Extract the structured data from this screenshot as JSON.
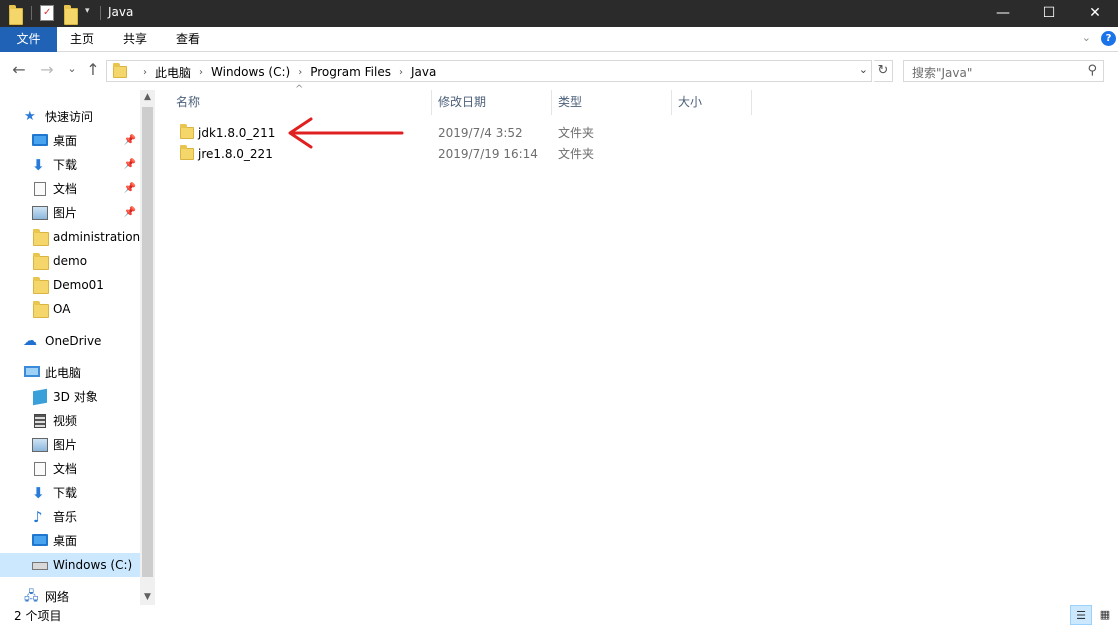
{
  "window": {
    "title": "Java",
    "minimize_glyph": "—",
    "maximize_glyph": "☐",
    "close_glyph": "✕"
  },
  "quick_access_toolbar": {
    "icons": [
      "folder-icon",
      "properties-icon",
      "new-folder-icon",
      "customize-dropdown-icon"
    ]
  },
  "ribbon": {
    "tabs": [
      {
        "label": "文件",
        "active": true
      },
      {
        "label": "主页"
      },
      {
        "label": "共享"
      },
      {
        "label": "查看"
      }
    ],
    "expand_glyph": "⌄",
    "help_glyph": "?"
  },
  "navigation": {
    "back_glyph": "←",
    "forward_glyph": "→",
    "recent_glyph": "⌄",
    "up_glyph": "↑"
  },
  "address_bar": {
    "crumbs": [
      "此电脑",
      "Windows (C:)",
      "Program Files",
      "Java"
    ],
    "separator": "›",
    "dropdown_glyph": "⌄",
    "refresh_glyph": "↻"
  },
  "search": {
    "placeholder": "搜索\"Java\"",
    "icon_glyph": "⚲"
  },
  "nav_pane": {
    "items": [
      {
        "label": "快速访问",
        "icon": "star-icon",
        "pinned": false,
        "level": 0
      },
      {
        "label": "桌面",
        "icon": "desktop-icon",
        "pinned": true,
        "level": 1
      },
      {
        "label": "下载",
        "icon": "download-icon",
        "pinned": true,
        "level": 1
      },
      {
        "label": "文档",
        "icon": "document-icon",
        "pinned": true,
        "level": 1
      },
      {
        "label": "图片",
        "icon": "pictures-icon",
        "pinned": true,
        "level": 1
      },
      {
        "label": "administration",
        "icon": "folder-icon",
        "pinned": false,
        "level": 1
      },
      {
        "label": "demo",
        "icon": "folder-icon",
        "pinned": false,
        "level": 1
      },
      {
        "label": "Demo01",
        "icon": "folder-icon",
        "pinned": false,
        "level": 1
      },
      {
        "label": "OA",
        "icon": "folder-icon",
        "pinned": false,
        "level": 1
      },
      {
        "label": "OneDrive",
        "icon": "onedrive-icon",
        "pinned": false,
        "level": 0
      },
      {
        "label": "此电脑",
        "icon": "this-pc-icon",
        "pinned": false,
        "level": 0
      },
      {
        "label": "3D 对象",
        "icon": "3d-objects-icon",
        "pinned": false,
        "level": 1
      },
      {
        "label": "视频",
        "icon": "video-icon",
        "pinned": false,
        "level": 1
      },
      {
        "label": "图片",
        "icon": "pictures-icon",
        "pinned": false,
        "level": 1
      },
      {
        "label": "文档",
        "icon": "document-icon",
        "pinned": false,
        "level": 1
      },
      {
        "label": "下载",
        "icon": "download-icon",
        "pinned": false,
        "level": 1
      },
      {
        "label": "音乐",
        "icon": "music-icon",
        "pinned": false,
        "level": 1
      },
      {
        "label": "桌面",
        "icon": "desktop-icon",
        "pinned": false,
        "level": 1
      },
      {
        "label": "Windows (C:)",
        "icon": "drive-icon",
        "pinned": false,
        "level": 1,
        "selected": true
      },
      {
        "label": "网络",
        "icon": "network-icon",
        "pinned": false,
        "level": 0
      }
    ],
    "pin_glyph": "📌"
  },
  "columns": [
    "名称",
    "修改日期",
    "类型",
    "大小"
  ],
  "sort_glyph": "^",
  "files": [
    {
      "name": "jdk1.8.0_211",
      "modified": "2019/7/4 3:52",
      "type": "文件夹",
      "size": ""
    },
    {
      "name": "jre1.8.0_221",
      "modified": "2019/7/19 16:14",
      "type": "文件夹",
      "size": ""
    }
  ],
  "annotation": {
    "color": "#e02020",
    "points_to": "jdk1.8.0_211"
  },
  "status_bar": {
    "item_count": "2 个项目"
  },
  "colors": {
    "titlebar": "#2b2b2b",
    "file_tab": "#2063b6",
    "selection": "#cce8ff",
    "folder": "#f5d66a"
  }
}
